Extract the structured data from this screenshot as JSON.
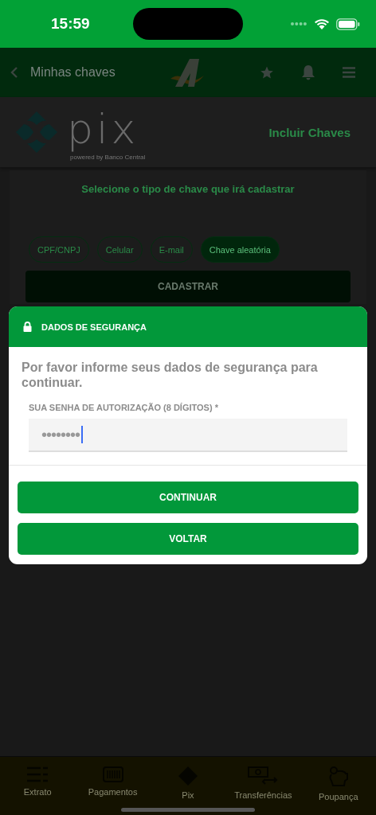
{
  "status_bar": {
    "time": "15:59"
  },
  "header": {
    "title": "Minhas chaves"
  },
  "pix": {
    "logo_text": "pix",
    "logo_caption": "powered by Banco Central",
    "heading": "Incluir Chaves"
  },
  "card": {
    "prompt": "Selecione o tipo de chave que irá cadastrar",
    "key_types": [
      {
        "label": "CPF/CNPJ",
        "selected": false
      },
      {
        "label": "Celular",
        "selected": false
      },
      {
        "label": "E-mail",
        "selected": false
      },
      {
        "label": "Chave aleatória",
        "selected": true
      }
    ],
    "submit": "CADASTRAR"
  },
  "dialog": {
    "title": "DADOS DE SEGURANÇA",
    "message": "Por favor informe seus dados de segurança para continuar.",
    "field": {
      "label": "SUA SENHA DE AUTORIZAÇÃO (8 DÍGITOS) *",
      "value": "••••••••",
      "focused": true
    },
    "buttons": [
      "CONTINUAR",
      "VOLTAR"
    ]
  },
  "bottom_nav": [
    {
      "label": "Extrato"
    },
    {
      "label": "Pagamentos"
    },
    {
      "label": "Pix"
    },
    {
      "label": "Transferências"
    },
    {
      "label": "Poupança"
    }
  ]
}
